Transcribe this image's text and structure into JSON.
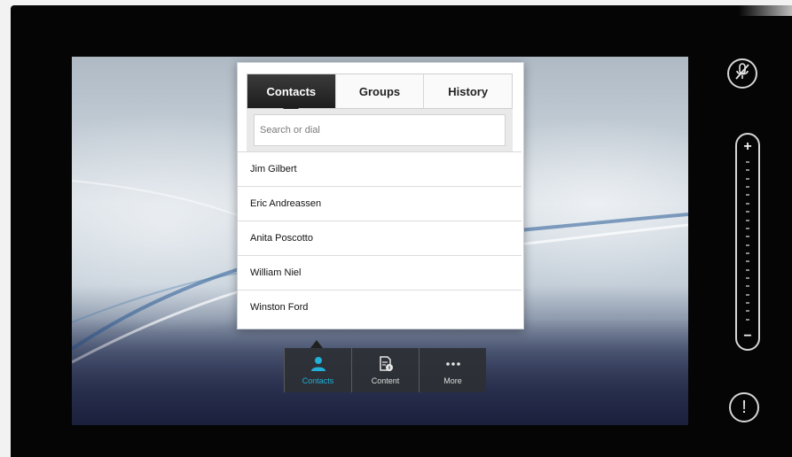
{
  "tabs": [
    {
      "label": "Contacts",
      "active": true
    },
    {
      "label": "Groups",
      "active": false
    },
    {
      "label": "History",
      "active": false
    }
  ],
  "search": {
    "placeholder": "Search or dial",
    "value": ""
  },
  "contacts": [
    {
      "name": "Jim Gilbert"
    },
    {
      "name": "Eric Andreassen"
    },
    {
      "name": "Anita Poscotto"
    },
    {
      "name": "William Niel"
    },
    {
      "name": "Winston Ford"
    }
  ],
  "bottombar": {
    "items": [
      {
        "label": "Contacts",
        "icon": "person-icon",
        "active": true
      },
      {
        "label": "Content",
        "icon": "document-info-icon",
        "active": false
      },
      {
        "label": "More",
        "icon": "more-dots-icon",
        "active": false
      }
    ]
  },
  "side": {
    "mute_icon": "microphone-muted-icon",
    "volume_plus": "+",
    "volume_minus": "−",
    "alert_symbol": "!"
  },
  "colors": {
    "accent": "#20b0d8",
    "active_tab": "#1d1d1d",
    "bezel": "#050505"
  }
}
